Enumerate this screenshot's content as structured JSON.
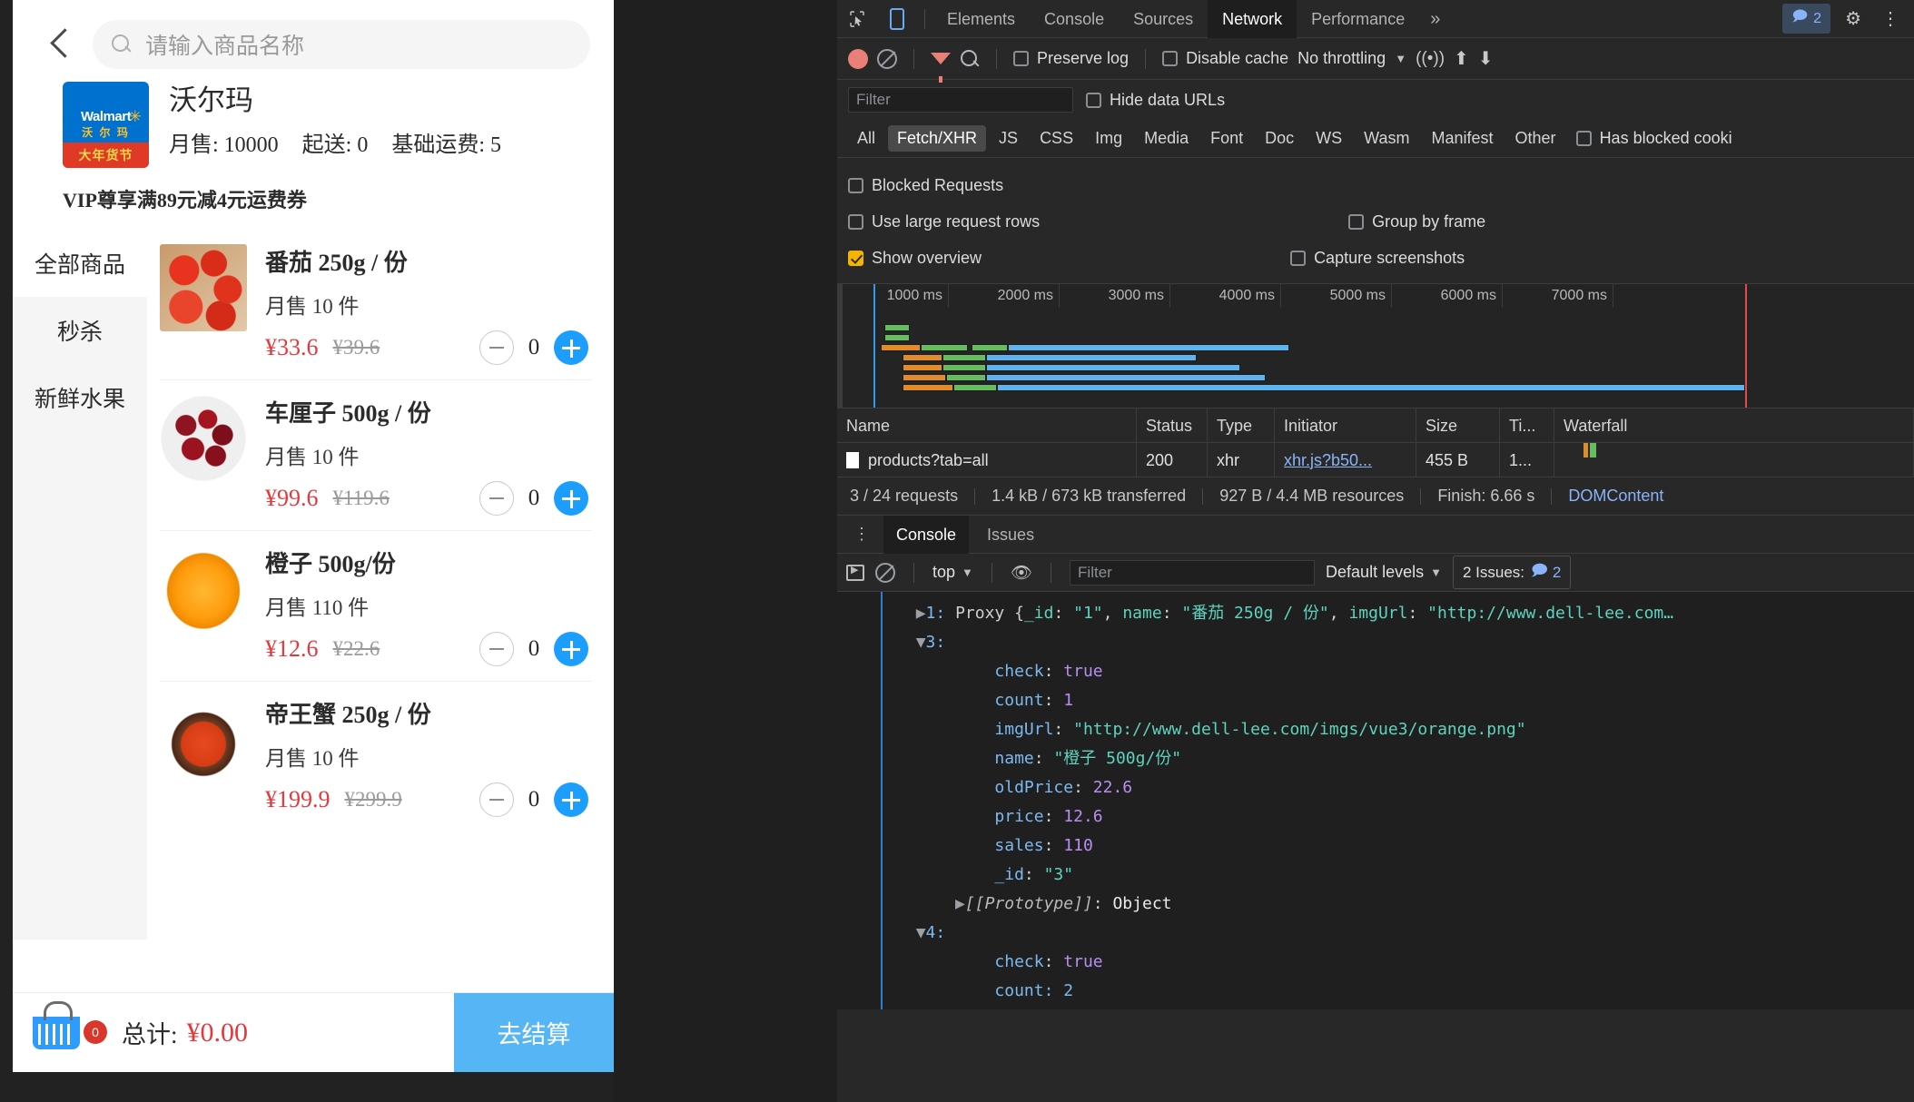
{
  "app": {
    "search": {
      "placeholder": "请输入商品名称",
      "icon": "search-icon"
    },
    "back_icon": "back-chevron-icon",
    "shop": {
      "logo_brand": "Walmart",
      "logo_brand_cn": "沃 尔 玛",
      "logo_banner": "大年货节",
      "name": "沃尔玛",
      "meta": [
        "月售: 10000",
        "起送: 0",
        "基础运费: 5"
      ],
      "coupon": "VIP尊享满89元减4元运费券"
    },
    "tabs": [
      {
        "label": "全部商品",
        "active": false
      },
      {
        "label": "秒杀",
        "active": true
      },
      {
        "label": "新鲜水果",
        "active": false
      }
    ],
    "sales_unit_prefix": "月售",
    "sales_unit_suffix": "件",
    "products": [
      {
        "name": "番茄 250g / 份",
        "sales": "月售 10 件",
        "price": "¥33.6",
        "old_price": "¥39.6",
        "count": "0",
        "img": "img-tomato"
      },
      {
        "name": "车厘子 500g / 份",
        "sales": "月售 10 件",
        "price": "¥99.6",
        "old_price": "¥119.6",
        "count": "0",
        "img": "img-cherry"
      },
      {
        "name": "橙子 500g/份",
        "sales": "月售 110 件",
        "price": "¥12.6",
        "old_price": "¥22.6",
        "count": "0",
        "img": "img-orange"
      },
      {
        "name": "帝王蟹 250g / 份",
        "sales": "月售 10 件",
        "price": "¥199.9",
        "old_price": "¥299.9",
        "count": "0",
        "img": "img-crab"
      }
    ],
    "checkout": {
      "badge": "0",
      "total_label": "总计:",
      "total_amount": "¥0.00",
      "button": "去结算"
    },
    "colors": {
      "accent_blue": "#1b9eff",
      "price_red": "#e4393c",
      "checkout_blue": "#56b6f5"
    }
  },
  "devtools": {
    "tabs": [
      {
        "label": "Elements",
        "active": false
      },
      {
        "label": "Console",
        "active": false
      },
      {
        "label": "Sources",
        "active": false
      },
      {
        "label": "Network",
        "active": true
      },
      {
        "label": "Performance",
        "active": false
      }
    ],
    "more_tabs": "»",
    "header_issues_count": "2",
    "network_toolbar": {
      "preserve_log": "Preserve log",
      "disable_cache": "Disable cache",
      "throttling": "No throttling",
      "filter_placeholder": "Filter",
      "hide_data_urls": "Hide data URLs"
    },
    "type_filters": [
      {
        "label": "All",
        "active": false
      },
      {
        "label": "Fetch/XHR",
        "active": true
      },
      {
        "label": "JS",
        "active": false
      },
      {
        "label": "CSS",
        "active": false
      },
      {
        "label": "Img",
        "active": false
      },
      {
        "label": "Media",
        "active": false
      },
      {
        "label": "Font",
        "active": false
      },
      {
        "label": "Doc",
        "active": false
      },
      {
        "label": "WS",
        "active": false
      },
      {
        "label": "Wasm",
        "active": false
      },
      {
        "label": "Manifest",
        "active": false
      },
      {
        "label": "Other",
        "active": false
      }
    ],
    "has_blocked_cookies": "Has blocked cooki",
    "options": {
      "blocked_requests": "Blocked Requests",
      "large_rows": "Use large request rows",
      "group_by_frame": "Group by frame",
      "show_overview": "Show overview",
      "capture_screenshots": "Capture screenshots"
    },
    "overview": {
      "ticks": [
        "1000 ms",
        "2000 ms",
        "3000 ms",
        "4000 ms",
        "5000 ms",
        "6000 ms",
        "7000 ms"
      ]
    },
    "table": {
      "headers": [
        "Name",
        "Status",
        "Type",
        "Initiator",
        "Size",
        "Ti...",
        "Waterfall"
      ],
      "rows": [
        {
          "name": "products?tab=all",
          "status": "200",
          "type": "xhr",
          "initiator": "xhr.js?b50...",
          "size": "455 B",
          "time": "1...",
          "waterfall": ""
        }
      ]
    },
    "summary": {
      "requests": "3 / 24 requests",
      "transferred": "1.4 kB / 673 kB transferred",
      "resources": "927 B / 4.4 MB resources",
      "finish": "Finish: 6.66 s",
      "domcontent": "DOMContent"
    },
    "console": {
      "tabs": [
        {
          "label": "Console",
          "active": true
        },
        {
          "label": "Issues",
          "active": false
        }
      ],
      "context": "top",
      "filter_placeholder": "Filter",
      "levels": "Default levels",
      "issues_label": "2 Issues:",
      "issues_count": "2",
      "lines": [
        {
          "indent": 2,
          "tri": "▶",
          "tokens": [
            {
              "t": "1: ",
              "c": "cl-blue"
            },
            {
              "t": "Proxy {",
              "c": "cl-gray"
            },
            {
              "t": "_id",
              "c": "cl-teal"
            },
            {
              "t": ": ",
              "c": "cl-gray"
            },
            {
              "t": "\"1\"",
              "c": "cl-teal"
            },
            {
              "t": ", ",
              "c": "cl-gray"
            },
            {
              "t": "name",
              "c": "cl-teal"
            },
            {
              "t": ": ",
              "c": "cl-gray"
            },
            {
              "t": "\"番茄 250g / 份\"",
              "c": "cl-teal"
            },
            {
              "t": ", ",
              "c": "cl-gray"
            },
            {
              "t": "imgUrl",
              "c": "cl-teal"
            },
            {
              "t": ": ",
              "c": "cl-gray"
            },
            {
              "t": "\"http://www.dell-lee.com…",
              "c": "cl-teal"
            }
          ]
        },
        {
          "indent": 2,
          "tri": "▼",
          "tokens": [
            {
              "t": "3:",
              "c": "cl-blue"
            }
          ]
        },
        {
          "indent": 4,
          "tri": "",
          "tokens": [
            {
              "t": "check",
              "c": "cl-blue"
            },
            {
              "t": ": ",
              "c": "cl-gray"
            },
            {
              "t": "true",
              "c": "cl-purple"
            }
          ]
        },
        {
          "indent": 4,
          "tri": "",
          "tokens": [
            {
              "t": "count",
              "c": "cl-blue"
            },
            {
              "t": ": ",
              "c": "cl-gray"
            },
            {
              "t": "1",
              "c": "cl-purple"
            }
          ]
        },
        {
          "indent": 4,
          "tri": "",
          "tokens": [
            {
              "t": "imgUrl",
              "c": "cl-blue"
            },
            {
              "t": ": ",
              "c": "cl-gray"
            },
            {
              "t": "\"http://www.dell-lee.com/imgs/vue3/orange.png\"",
              "c": "cl-teal"
            }
          ]
        },
        {
          "indent": 4,
          "tri": "",
          "tokens": [
            {
              "t": "name",
              "c": "cl-blue"
            },
            {
              "t": ": ",
              "c": "cl-gray"
            },
            {
              "t": "\"橙子 500g/份\"",
              "c": "cl-teal"
            }
          ]
        },
        {
          "indent": 4,
          "tri": "",
          "tokens": [
            {
              "t": "oldPrice",
              "c": "cl-blue"
            },
            {
              "t": ": ",
              "c": "cl-gray"
            },
            {
              "t": "22.6",
              "c": "cl-purple"
            }
          ]
        },
        {
          "indent": 4,
          "tri": "",
          "tokens": [
            {
              "t": "price",
              "c": "cl-blue"
            },
            {
              "t": ": ",
              "c": "cl-gray"
            },
            {
              "t": "12.6",
              "c": "cl-purple"
            }
          ]
        },
        {
          "indent": 4,
          "tri": "",
          "tokens": [
            {
              "t": "sales",
              "c": "cl-blue"
            },
            {
              "t": ": ",
              "c": "cl-gray"
            },
            {
              "t": "110",
              "c": "cl-purple"
            }
          ]
        },
        {
          "indent": 4,
          "tri": "",
          "tokens": [
            {
              "t": "_id",
              "c": "cl-blue"
            },
            {
              "t": ": ",
              "c": "cl-gray"
            },
            {
              "t": "\"3\"",
              "c": "cl-teal"
            }
          ]
        },
        {
          "indent": 3,
          "tri": "▶",
          "tokens": [
            {
              "t": "[[Prototype]]",
              "c": "cl-ital"
            },
            {
              "t": ": ",
              "c": "cl-gray"
            },
            {
              "t": "Object",
              "c": "cl-white"
            }
          ]
        },
        {
          "indent": 2,
          "tri": "▼",
          "tokens": [
            {
              "t": "4:",
              "c": "cl-blue"
            }
          ]
        },
        {
          "indent": 4,
          "tri": "",
          "tokens": [
            {
              "t": "check",
              "c": "cl-blue"
            },
            {
              "t": ": ",
              "c": "cl-gray"
            },
            {
              "t": "true",
              "c": "cl-purple"
            }
          ]
        },
        {
          "indent": 4,
          "tri": "",
          "tokens": [
            {
              "t": "count: 2",
              "c": "cl-blue"
            }
          ]
        }
      ]
    }
  }
}
